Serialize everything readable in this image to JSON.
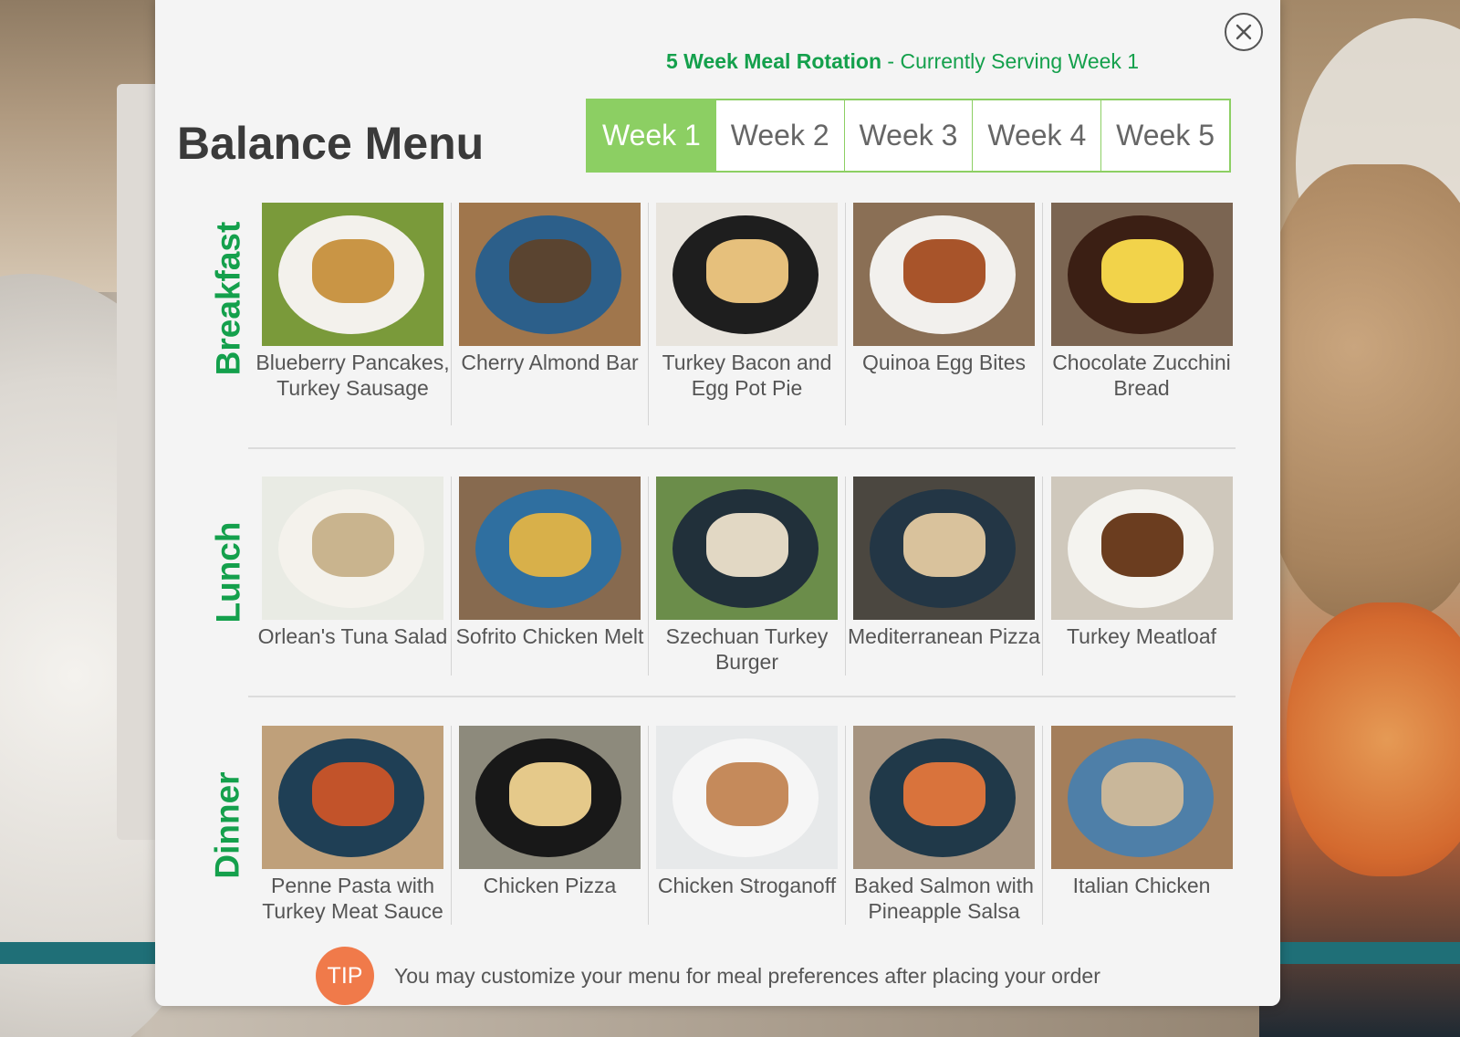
{
  "banner": {
    "rotation_strong": "5 Week Meal Rotation",
    "rotation_rest": " - Currently Serving Week 1"
  },
  "menu": {
    "title": "Balance Menu"
  },
  "weeks": [
    {
      "label": "Week 1",
      "active": true
    },
    {
      "label": "Week 2",
      "active": false
    },
    {
      "label": "Week 3",
      "active": false
    },
    {
      "label": "Week 4",
      "active": false
    },
    {
      "label": "Week 5",
      "active": false
    }
  ],
  "sections": {
    "breakfast": {
      "label": "Breakfast",
      "meals": [
        {
          "name": "Blueberry Pancakes, Turkey Sausage",
          "photo": "plate-pancakes-sausage",
          "bg": "#7a9a3a",
          "plate": "#f3f1ec",
          "food": "#c99545"
        },
        {
          "name": "Cherry Almond Bar",
          "photo": "blue-plate-bar",
          "bg": "#a0764c",
          "plate": "#2c5f8a",
          "food": "#5a4430"
        },
        {
          "name": "Turkey Bacon and Egg Pot Pie",
          "photo": "black-plate-pot-pie",
          "bg": "#e8e4dd",
          "plate": "#1e1e1e",
          "food": "#e6c07c"
        },
        {
          "name": "Quinoa Egg Bites",
          "photo": "white-plate-egg-bites",
          "bg": "#8a6f55",
          "plate": "#f2f0ed",
          "food": "#a8542a"
        },
        {
          "name": "Chocolate Zucchini Bread",
          "photo": "dark-plate-bread",
          "bg": "#7b6552",
          "plate": "#3b1f14",
          "food": "#f2d34a"
        }
      ]
    },
    "lunch": {
      "label": "Lunch",
      "meals": [
        {
          "name": "Orlean's Tuna Salad",
          "photo": "plate-tuna-salad",
          "bg": "#e9ebe4",
          "plate": "#f4f2ec",
          "food": "#c9b48e"
        },
        {
          "name": "Sofrito Chicken Melt",
          "photo": "blue-plate-chicken-melt",
          "bg": "#876a4f",
          "plate": "#2f6fa0",
          "food": "#d8b04a"
        },
        {
          "name": "Szechuan Turkey Burger",
          "photo": "dark-plate-turkey-burger",
          "bg": "#6b8d4a",
          "plate": "#21303a",
          "food": "#e2d8c4"
        },
        {
          "name": "Mediterranean Pizza",
          "photo": "dark-plate-pizza",
          "bg": "#4b4740",
          "plate": "#233645",
          "food": "#d9c29c"
        },
        {
          "name": "Turkey Meatloaf",
          "photo": "white-plate-meatloaf",
          "bg": "#cfc8bc",
          "plate": "#f4f3ef",
          "food": "#6b3d1f"
        }
      ]
    },
    "dinner": {
      "label": "Dinner",
      "meals": [
        {
          "name": "Penne Pasta with Turkey Meat Sauce",
          "photo": "blue-plate-penne",
          "bg": "#bfa07a",
          "plate": "#1f3f55",
          "food": "#c2532a"
        },
        {
          "name": "Chicken Pizza",
          "photo": "black-plate-chicken-pizza",
          "bg": "#8d8a7c",
          "plate": "#181818",
          "food": "#e5c98a"
        },
        {
          "name": "Chicken Stroganoff",
          "photo": "white-bowl-stroganoff",
          "bg": "#e7e9ea",
          "plate": "#f6f6f6",
          "food": "#c58a5b"
        },
        {
          "name": "Baked Salmon with Pineapple Salsa",
          "photo": "dark-plate-salmon",
          "bg": "#a69480",
          "plate": "#203949",
          "food": "#d9733c"
        },
        {
          "name": "Italian Chicken",
          "photo": "blue-plate-italian-chicken",
          "bg": "#a47e5a",
          "plate": "#4e7fa8",
          "food": "#c9b79a"
        }
      ]
    }
  },
  "tip": {
    "badge": "TIP",
    "text": "You may customize your menu for meal preferences after placing your order"
  },
  "icons": {
    "close": "close-icon"
  },
  "colors": {
    "brand_green": "#14a04c",
    "tab_green": "#8ccf63",
    "tip_orange": "#f07a4a"
  }
}
